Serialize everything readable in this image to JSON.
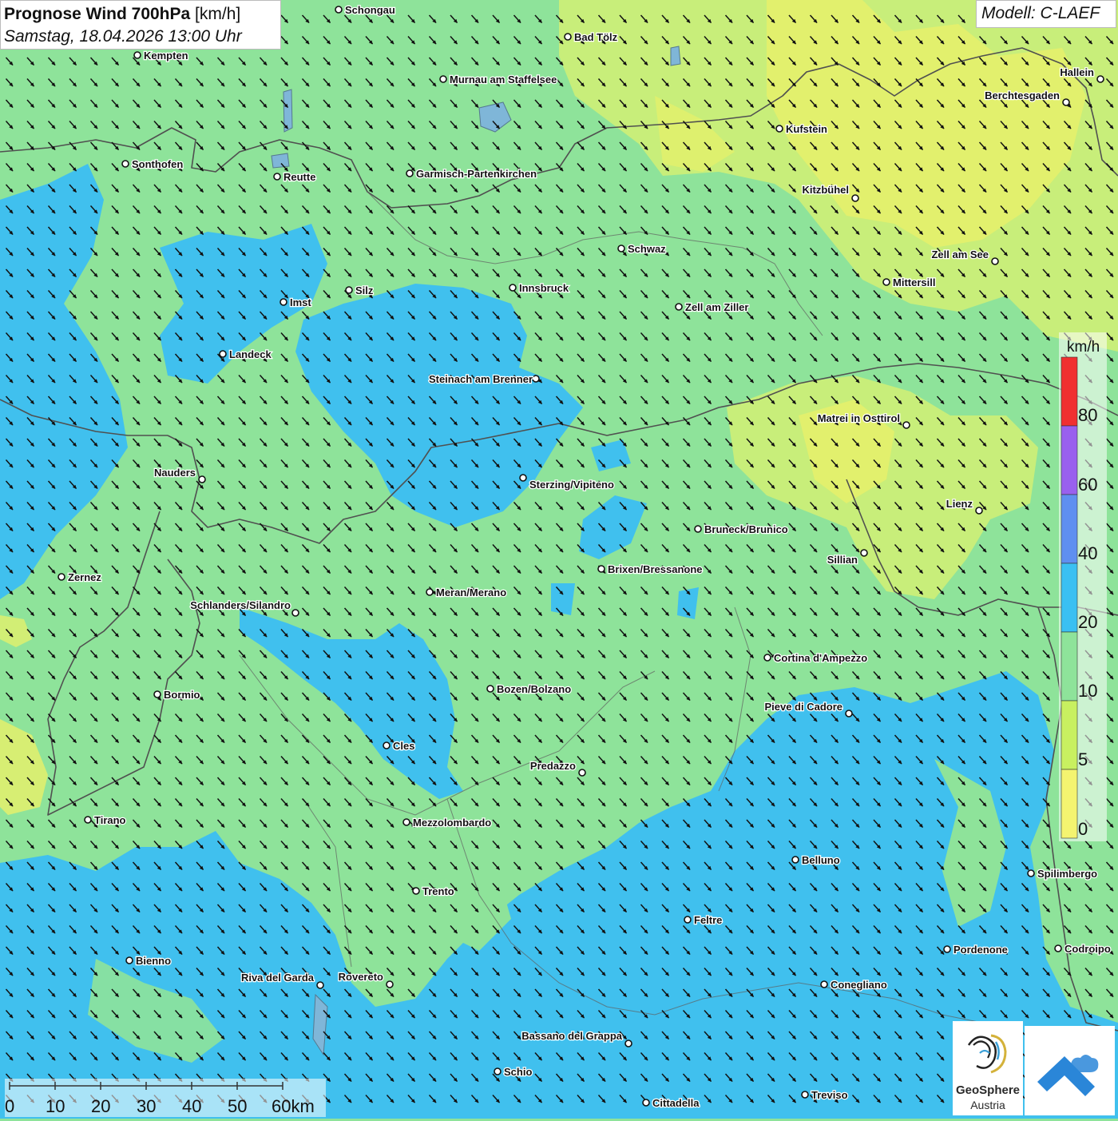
{
  "header": {
    "title": "Prognose Wind 700hPa",
    "unit": "[km/h]",
    "datetime": "Samstag, 18.04.2026 13:00 Uhr",
    "model": "Modell: C-LAEF"
  },
  "legend": {
    "unit": "km/h",
    "bands": [
      {
        "from": 80,
        "color": "#f03030"
      },
      {
        "from": 60,
        "color": "#9960ee"
      },
      {
        "from": 40,
        "color": "#5f8ff0"
      },
      {
        "from": 20,
        "color": "#3ac0f2"
      },
      {
        "from": 10,
        "color": "#8ee39a"
      },
      {
        "from": 5,
        "color": "#c8f060"
      },
      {
        "from": 0,
        "color": "#f4f470"
      }
    ],
    "labels": [
      "80",
      "60",
      "40",
      "20",
      "10",
      "5",
      "0"
    ]
  },
  "scalebar": {
    "labels": [
      "0",
      "10",
      "20",
      "30",
      "40",
      "50",
      "60km"
    ]
  },
  "logos": {
    "geosphere_line1": "GeoSphere",
    "geosphere_line2": "Austria"
  },
  "colors": {
    "background": "#8ee39a",
    "calm_zone": "#e4f06c",
    "calm_zone_light": "#c8ee7a",
    "fast_zone": "#40c0ee",
    "arrow": "#111111",
    "border": "#505050",
    "city_marker": "#ffffff"
  },
  "wind_arrows": {
    "direction": "north-west (blowing toward south-east)"
  },
  "cities": [
    {
      "name": "Schongau"
    },
    {
      "name": "Bad Tölz"
    },
    {
      "name": "Kempten"
    },
    {
      "name": "Murnau am Staffelsee"
    },
    {
      "name": "Hallein"
    },
    {
      "name": "Berchtesgaden"
    },
    {
      "name": "Kufstein"
    },
    {
      "name": "Sonthofen"
    },
    {
      "name": "Reutte"
    },
    {
      "name": "Garmisch-Partenkirchen"
    },
    {
      "name": "Kitzbühel"
    },
    {
      "name": "Schwaz"
    },
    {
      "name": "Zell am See"
    },
    {
      "name": "Mittersill"
    },
    {
      "name": "Innsbruck"
    },
    {
      "name": "Silz"
    },
    {
      "name": "Imst"
    },
    {
      "name": "Zell am Ziller"
    },
    {
      "name": "Landeck"
    },
    {
      "name": "Steinach am Brenner"
    },
    {
      "name": "Matrei in Osttirol"
    },
    {
      "name": "Nauders"
    },
    {
      "name": "Sterzing/Vipiteno"
    },
    {
      "name": "Lienz"
    },
    {
      "name": "Bruneck/Brunico"
    },
    {
      "name": "Sillian"
    },
    {
      "name": "Brixen/Bressanone"
    },
    {
      "name": "Zernez"
    },
    {
      "name": "Meran/Merano"
    },
    {
      "name": "Schlanders/Silandro"
    },
    {
      "name": "Cortina d'Ampezzo"
    },
    {
      "name": "Bozen/Bolzano"
    },
    {
      "name": "Bormio"
    },
    {
      "name": "Pieve di Cadore"
    },
    {
      "name": "Cles"
    },
    {
      "name": "Predazzo"
    },
    {
      "name": "Tirano"
    },
    {
      "name": "Mezzolombardo"
    },
    {
      "name": "Belluno"
    },
    {
      "name": "Spilimbergo"
    },
    {
      "name": "Trento"
    },
    {
      "name": "Feltre"
    },
    {
      "name": "Pordenone"
    },
    {
      "name": "Codroipo"
    },
    {
      "name": "Bienno"
    },
    {
      "name": "Riva del Garda"
    },
    {
      "name": "Rovereto"
    },
    {
      "name": "Conegliano"
    },
    {
      "name": "Bassano del Grappa"
    },
    {
      "name": "Schio"
    },
    {
      "name": "Treviso"
    },
    {
      "name": "Cittadella"
    }
  ]
}
